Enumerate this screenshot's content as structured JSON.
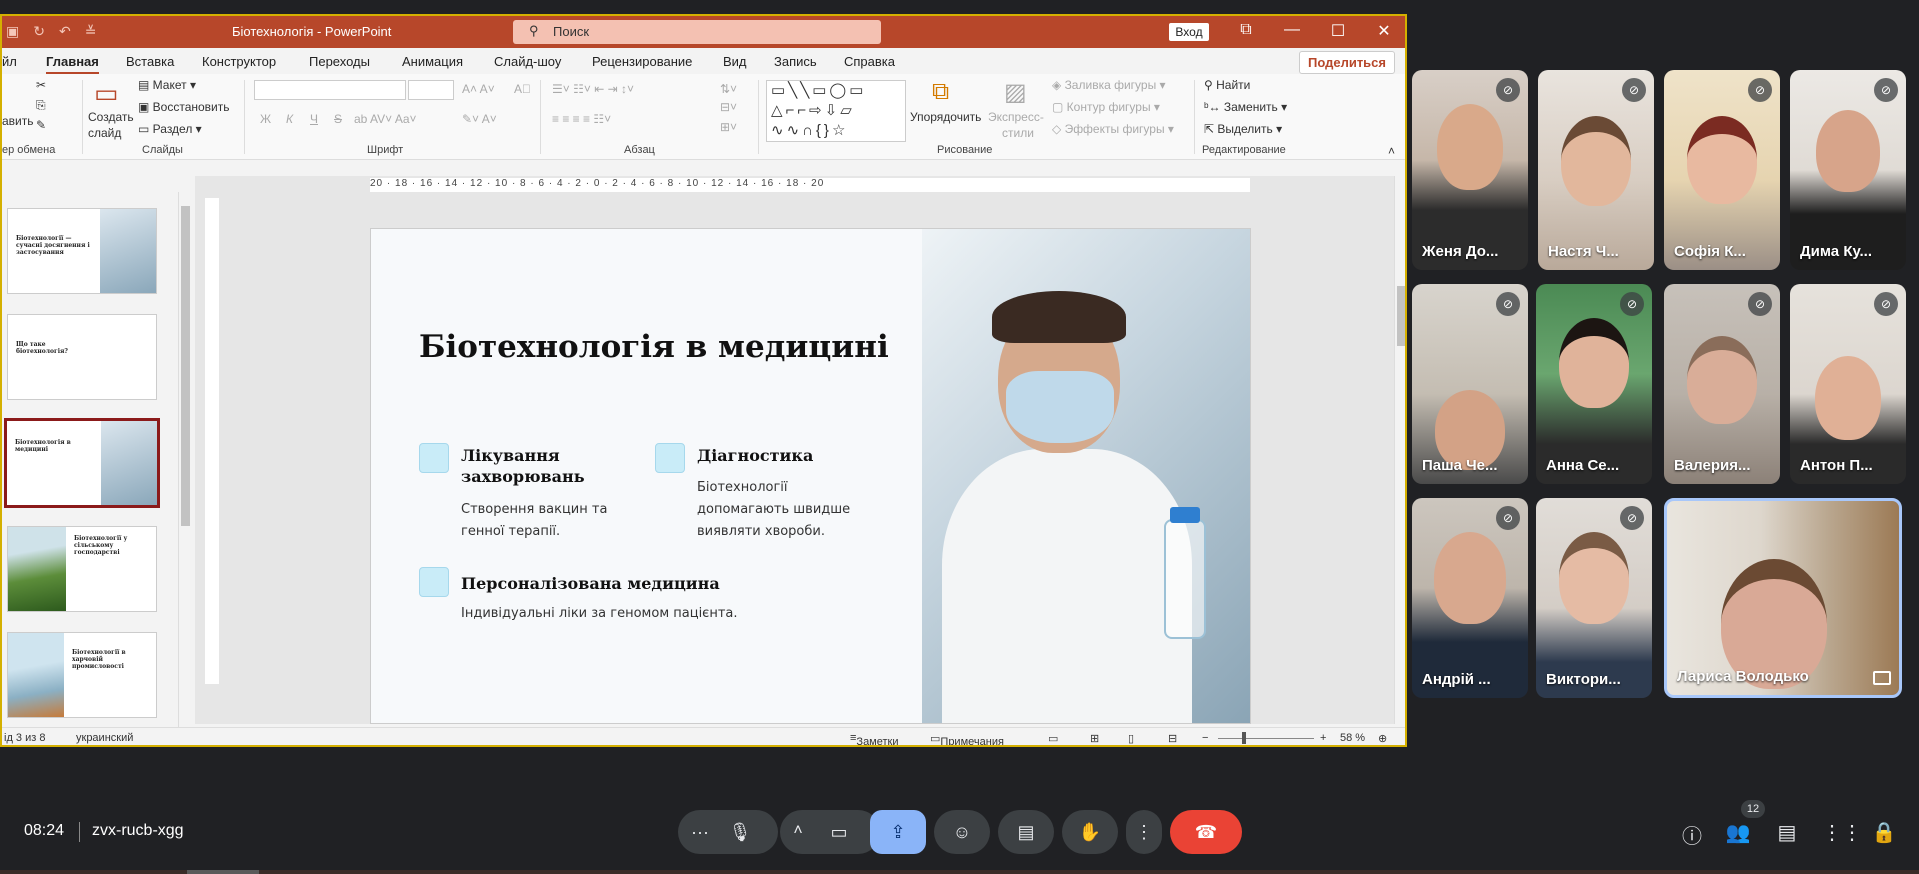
{
  "powerpoint": {
    "title": "Біотехнологія  -  PowerPoint",
    "search_placeholder": "Поиск",
    "login_label": "Вход",
    "tabs": [
      "йл",
      "Главная",
      "Вставка",
      "Конструктор",
      "Переходы",
      "Анимация",
      "Слайд-шоу",
      "Рецензирование",
      "Вид",
      "Запись",
      "Справка"
    ],
    "share_label": "Поделиться",
    "ribbon": {
      "clipboard": {
        "paste": "авить",
        "label": "ер обмена"
      },
      "slides": {
        "create": "Создать",
        "create2": "слайд",
        "layout": "Макет",
        "reset": "Восстановить",
        "section": "Раздел",
        "label": "Слайды"
      },
      "font": {
        "label": "Шрифт",
        "bold": "Ж",
        "italic": "К",
        "underline": "Ч",
        "strike": "S"
      },
      "paragraph": {
        "label": "Абзац"
      },
      "drawing": {
        "arrange": "Упорядочить",
        "express1": "Экспресс-",
        "express2": "стили",
        "fill": "Заливка фигуры",
        "outline": "Контур фигуры",
        "effects": "Эффекты фигуры",
        "label": "Рисование"
      },
      "editing": {
        "find": "Найти",
        "replace": "Заменить",
        "select": "Выделить",
        "label": "Редактирование"
      }
    },
    "thumbs": [
      {
        "title": "Біотехнології — сучасні досягнення і застосування"
      },
      {
        "title": "Що таке біотехнологія?"
      },
      {
        "title": "Біотехнологія в медицині"
      },
      {
        "title": "Біотехнології у сільському господарстві"
      },
      {
        "title": "Біотехнології в харчовій промисловості"
      }
    ],
    "ruler_text": "20 · 18 · 16 · 14 · 12 · 10 · 8 · 6 · 4 · 2 · 0 · 2 · 4 · 6 · 8 · 10 · 12 · 14 · 16 · 18 · 20",
    "slide": {
      "title": "Біотехнологія в медицині",
      "cards": [
        {
          "head": "Лікування захворювань",
          "text": "Створення вакцин та генної терапії."
        },
        {
          "head": "Діагностика",
          "text": "Біотехнології допомагають швидше виявляти хвороби."
        },
        {
          "head": "Персоналізована медицина",
          "text": "Індивідуальні ліки за геномом пацієнта."
        }
      ]
    },
    "status": {
      "slide_of": "ід 3 из 8",
      "language": "украинский",
      "notes": "Заметки",
      "comments": "Примечания",
      "zoom": "58 %"
    }
  },
  "meet": {
    "participants": [
      {
        "name": "Женя До..."
      },
      {
        "name": "Настя Ч..."
      },
      {
        "name": "Софія К..."
      },
      {
        "name": "Дима Ку..."
      },
      {
        "name": "Паша Че..."
      },
      {
        "name": "Анна Се..."
      },
      {
        "name": "Валерия..."
      },
      {
        "name": "Антон П..."
      },
      {
        "name": "Андрій ..."
      },
      {
        "name": "Виктори..."
      },
      {
        "name": "Лариса Володько"
      }
    ],
    "time": "08:24",
    "meeting_code": "zvx-rucb-xgg",
    "people_count": "12"
  }
}
